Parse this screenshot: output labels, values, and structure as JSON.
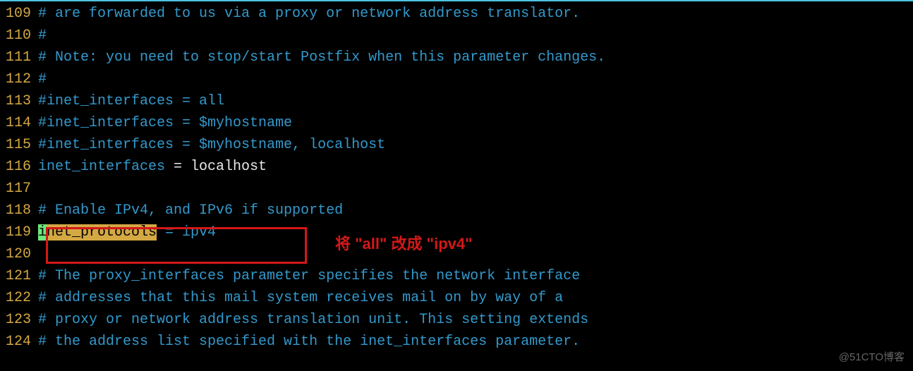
{
  "lines": [
    {
      "num": "109",
      "type": "comment",
      "text": "# are forwarded to us via a proxy or network address translator."
    },
    {
      "num": "110",
      "type": "comment",
      "text": "#"
    },
    {
      "num": "111",
      "type": "comment",
      "text": "# Note: you need to stop/start Postfix when this parameter changes."
    },
    {
      "num": "112",
      "type": "comment",
      "text": "#"
    },
    {
      "num": "113",
      "type": "comment",
      "text": "#inet_interfaces = all"
    },
    {
      "num": "114",
      "type": "comment",
      "text": "#inet_interfaces = $myhostname"
    },
    {
      "num": "115",
      "type": "comment",
      "text": "#inet_interfaces = $myhostname, localhost"
    },
    {
      "num": "116",
      "type": "kv",
      "key": "inet_interfaces",
      "val": "localhost"
    },
    {
      "num": "117",
      "type": "blank",
      "text": ""
    },
    {
      "num": "118",
      "type": "comment",
      "text": "# Enable IPv4, and IPv6 if supported"
    },
    {
      "num": "119",
      "type": "highlighted",
      "cursor_char": "i",
      "search_rest": "net_protocols",
      "val": "ipv4"
    },
    {
      "num": "120",
      "type": "blank",
      "text": ""
    },
    {
      "num": "121",
      "type": "comment",
      "text": "# The proxy_interfaces parameter specifies the network interface"
    },
    {
      "num": "122",
      "type": "comment",
      "text": "# addresses that this mail system receives mail on by way of a"
    },
    {
      "num": "123",
      "type": "comment",
      "text": "# proxy or network address translation unit. This setting extends"
    },
    {
      "num": "124",
      "type": "comment",
      "text": "# the address list specified with the inet_interfaces parameter."
    }
  ],
  "annotation": "将 \"all\" 改成 \"ipv4\"",
  "watermark": "@51CTO博客"
}
